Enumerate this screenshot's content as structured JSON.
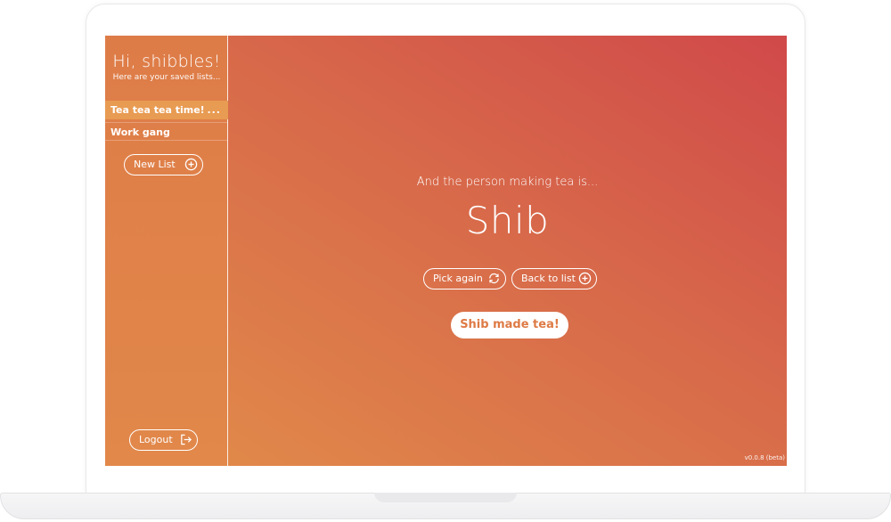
{
  "sidebar": {
    "greeting": "Hi, shibbles!",
    "subtitle": "Here are your saved lists...",
    "lists": [
      {
        "label": "Tea tea tea time!",
        "active": true
      },
      {
        "label": "Work gang",
        "active": false
      }
    ],
    "more_icon": "...",
    "new_list_label": "New List",
    "logout_label": "Logout"
  },
  "main": {
    "prompt": "And the person making tea is...",
    "chosen_name": "Shib",
    "pick_again_label": "Pick again",
    "back_to_list_label": "Back to list",
    "made_tea_label": "Shib made tea!"
  },
  "footer": {
    "version": "v0.0.8 (beta)"
  },
  "icons": {
    "more": "more-horizontal-icon",
    "new_list": "plus-circle-icon",
    "logout": "logout-icon",
    "pick_again": "refresh-icon",
    "back_to_list": "plus-circle-icon"
  },
  "colors": {
    "gradient_start": "#e28e4a",
    "gradient_mid": "#d86b4a",
    "gradient_end": "#d0494a",
    "active_item": "#e89b52",
    "button_text": "#de7a45"
  }
}
